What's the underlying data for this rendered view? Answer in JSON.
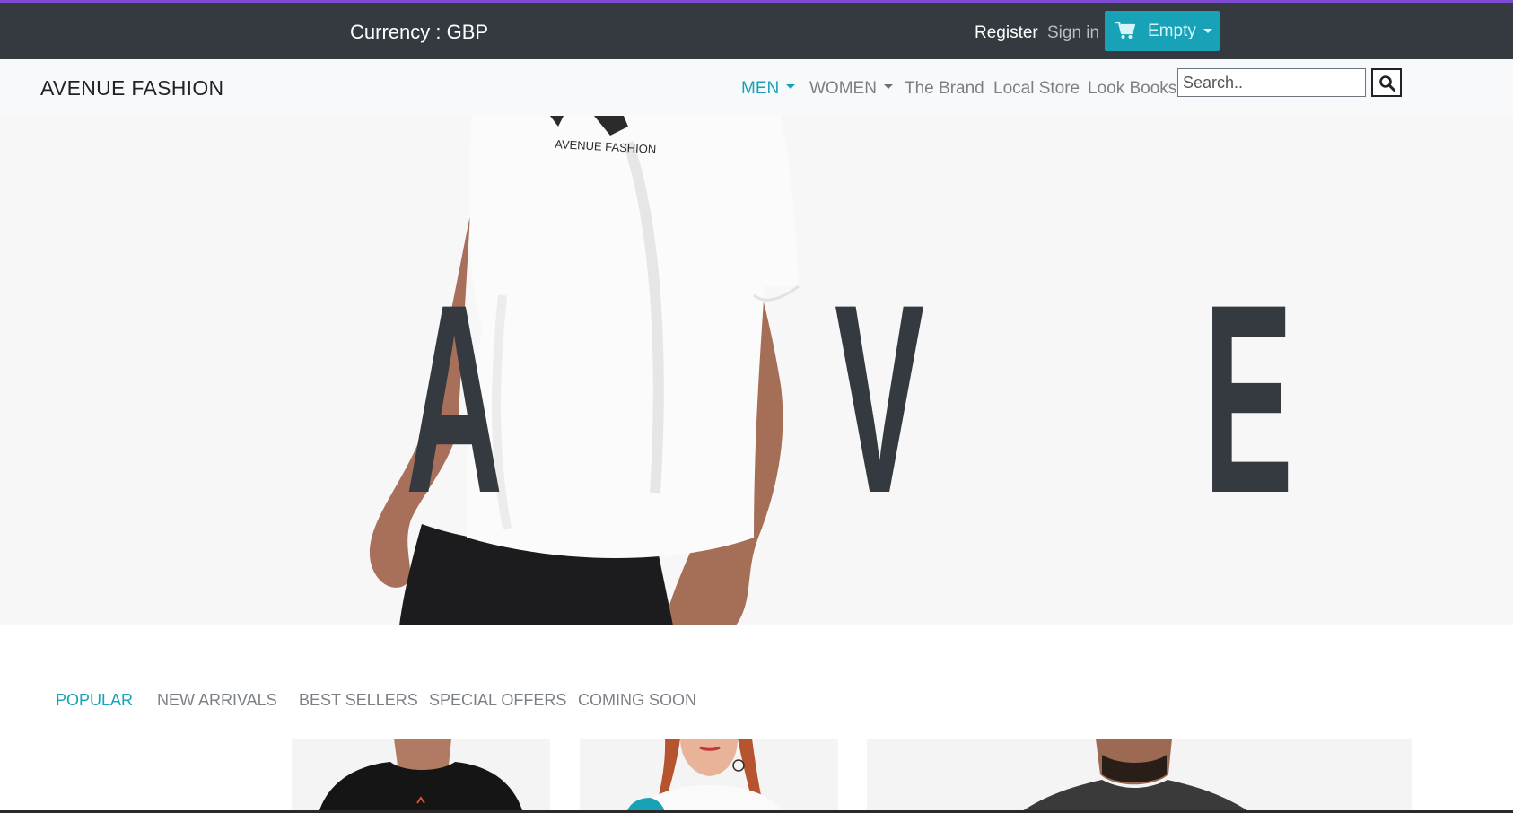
{
  "topbar": {
    "currency_label": "Currency : GBP",
    "register_label": "Register",
    "signin_label": "Sign in",
    "cart_label": "Empty",
    "cart_icon": "shopping-cart-icon"
  },
  "navbar": {
    "brand": "AVENUE FASHION",
    "items": [
      {
        "label": "MEN",
        "dropdown": true,
        "active": true
      },
      {
        "label": "WOMEN",
        "dropdown": true,
        "active": false
      },
      {
        "label": "The Brand",
        "dropdown": false,
        "active": false
      },
      {
        "label": "Local Store",
        "dropdown": false,
        "active": false
      },
      {
        "label": "Look Books",
        "dropdown": false,
        "active": false
      }
    ],
    "search_placeholder": "Search..",
    "search_icon": "search-icon"
  },
  "hero": {
    "shirt_text": "AVENUE FASHION",
    "letters": [
      "A",
      "V",
      "E"
    ]
  },
  "tabs": [
    {
      "label": "POPULAR",
      "active": true
    },
    {
      "label": "NEW ARRIVALS",
      "active": false
    },
    {
      "label": "BEST SELLERS",
      "active": false
    },
    {
      "label": "SPECIAL OFFERS",
      "active": false
    },
    {
      "label": "COMING SOON",
      "active": false
    }
  ],
  "colors": {
    "accent": "#17a2b8",
    "topbar_bg": "#343a40",
    "top_border": "#7d4ad2",
    "navbar_bg": "#f8f9fa",
    "hero_bg": "#f7f7f7",
    "hero_letter": "#343a40"
  }
}
